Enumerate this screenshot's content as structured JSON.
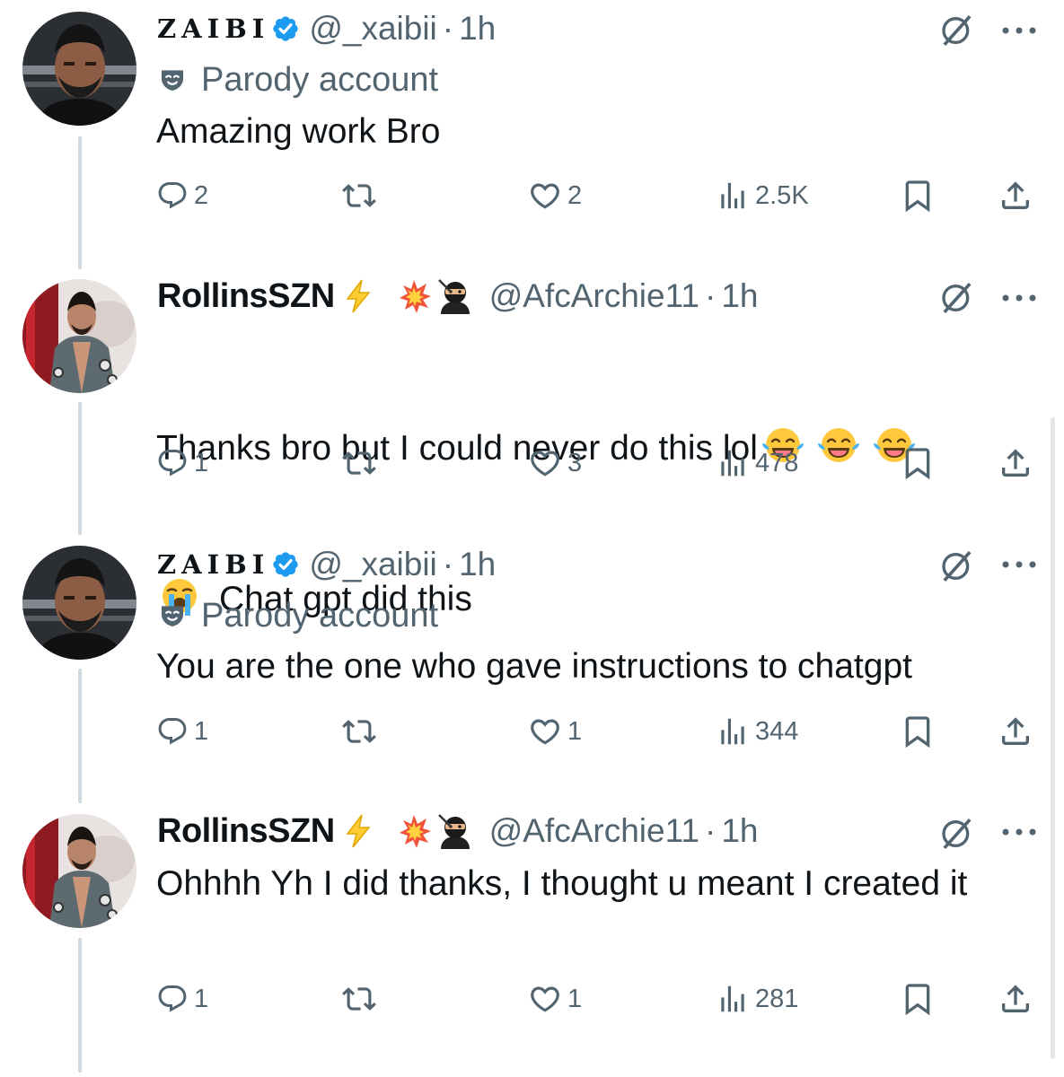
{
  "replies": [
    {
      "name": "ZAIBI",
      "handle": "@_xaibii",
      "dot": "·",
      "time": "1h",
      "verified": true,
      "parody_label": "Parody account",
      "text": "Amazing work Bro",
      "replies": "2",
      "likes": "2",
      "views": "2.5K"
    },
    {
      "name": "RollinsSZN",
      "handle": "@AfcArchie11",
      "dot": "·",
      "time": "1h",
      "name_emojis": [
        "lightning-emoji",
        "collision-emoji",
        "ninja-emoji"
      ],
      "text_line1": "Thanks bro but I could never do this lol",
      "text_line2": "Chat gpt did this",
      "text_emojis": [
        "face-with-tears-of-joy",
        "face-with-tears-of-joy",
        "face-with-tears-of-joy",
        "loudly-crying-face"
      ],
      "replies": "1",
      "likes": "3",
      "views": "478"
    },
    {
      "name": "ZAIBI",
      "handle": "@_xaibii",
      "dot": "·",
      "time": "1h",
      "verified": true,
      "parody_label": "Parody account",
      "text": "You are the one who gave instructions to chatgpt",
      "replies": "1",
      "likes": "1",
      "views": "344"
    },
    {
      "name": "RollinsSZN",
      "handle": "@AfcArchie11",
      "dot": "·",
      "time": "1h",
      "name_emojis": [
        "lightning-emoji",
        "collision-emoji",
        "ninja-emoji"
      ],
      "text": "Ohhhh Yh I did thanks, I thought u meant I created it",
      "replies": "1",
      "likes": "1",
      "views": "281"
    }
  ],
  "colors": {
    "text": "#0f1419",
    "secondary": "#536471",
    "verified": "#1d9bf0",
    "thread_line": "#cfd9de"
  },
  "icons": [
    "reply-icon",
    "retweet-icon",
    "like-icon",
    "views-icon",
    "bookmark-icon",
    "share-icon",
    "grok-icon",
    "more-icon",
    "parody-mask-icon",
    "verified-badge-icon"
  ]
}
